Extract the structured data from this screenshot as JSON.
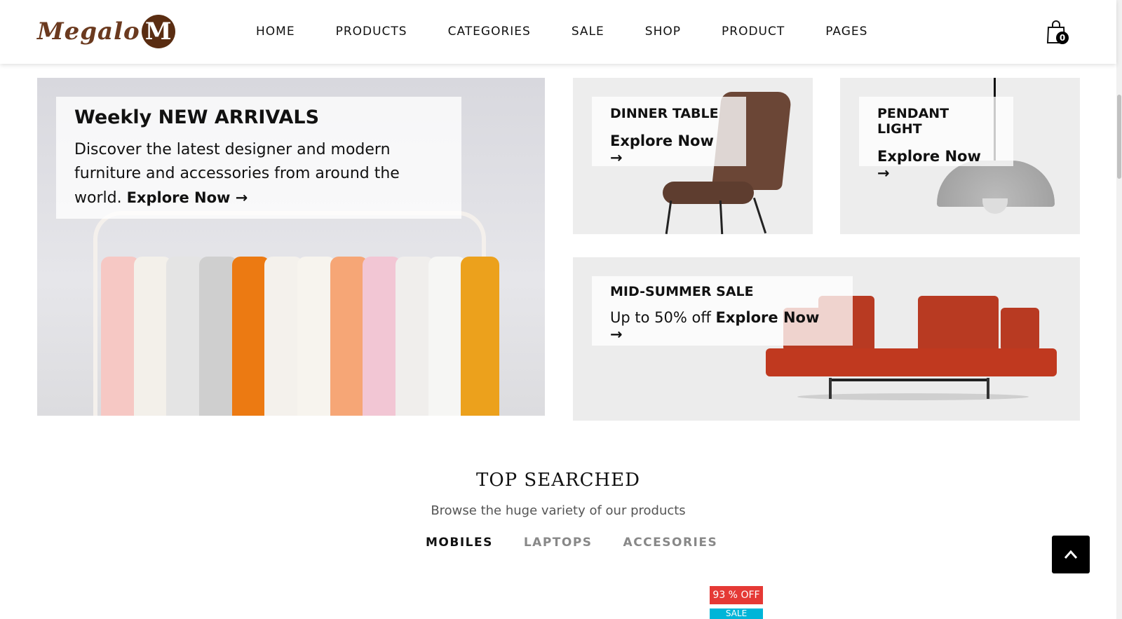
{
  "header": {
    "logo_text": "Megalo",
    "logo_badge": "M",
    "nav": [
      "HOME",
      "PRODUCTS",
      "CATEGORIES",
      "SALE",
      "SHOP",
      "PRODUCT",
      "PAGES"
    ],
    "cart_count": "0"
  },
  "banners": {
    "main": {
      "title": "Weekly NEW ARRIVALS",
      "text": "Discover the latest designer and modern furniture and accessories from around the world.",
      "link": "Explore Now"
    },
    "dinner_table": {
      "title": "DINNER TABLE",
      "link": "Explore Now"
    },
    "pendant_light": {
      "title": "PENDANT LIGHT",
      "link": "Explore Now"
    },
    "sale": {
      "title": "MID-SUMMER SALE",
      "text": "Up to 50% off",
      "link": "Explore Now"
    }
  },
  "top_searched": {
    "title": "TOP SEARCHED",
    "subtitle": "Browse the huge variety of our products",
    "tabs": [
      "MOBILES",
      "LAPTOPS",
      "ACCESORIES"
    ],
    "active_tab": "MOBILES"
  },
  "product_badges": {
    "discount": "93 % OFF",
    "sale": "SALE"
  },
  "colors": {
    "brand_brown": "#5a2d12",
    "discount_red": "#e53935",
    "sale_cyan": "#00b5d8"
  }
}
